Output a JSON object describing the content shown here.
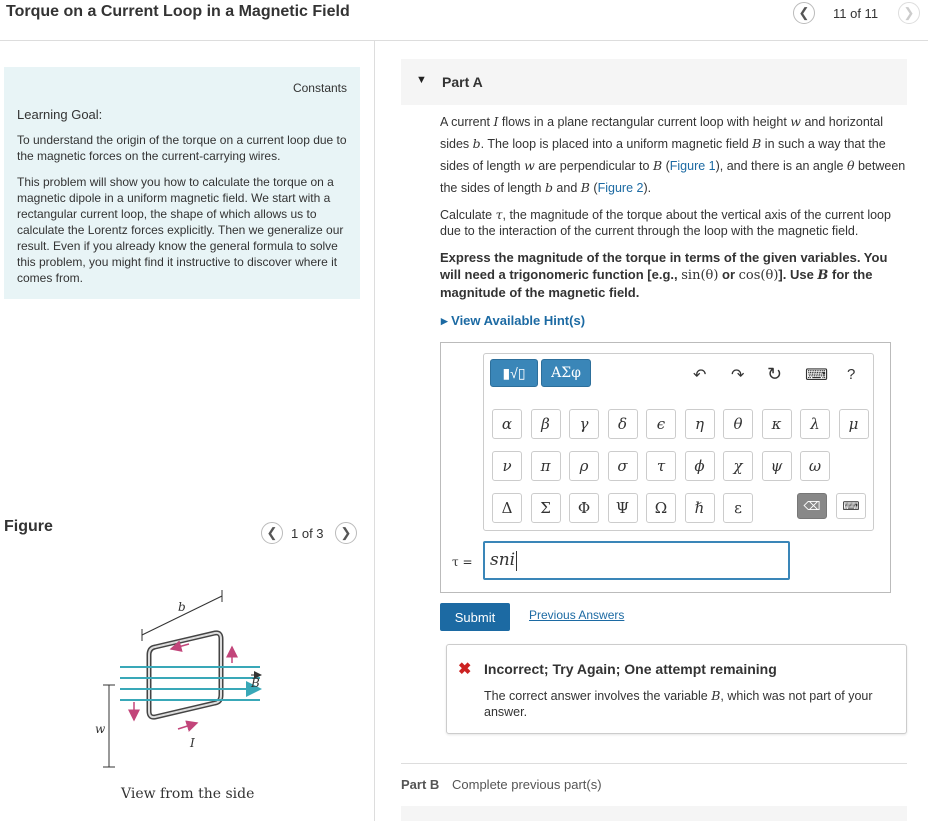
{
  "header": {
    "title": "Torque on a Current Loop in a Magnetic Field",
    "counter": "11 of 11"
  },
  "goal_panel": {
    "constants": "Constants",
    "heading": "Learning Goal:",
    "p1": "To understand the origin of the torque on a current loop due to the magnetic forces on the current-carrying wires.",
    "p2": "This problem will show you how to calculate the torque on a magnetic dipole in a uniform magnetic field. We start with a rectangular current loop, the shape of which allows us to calculate the Lorentz forces explicitly. Then we generalize our result. Even if you already know the general formula to solve this problem, you might find it instructive to discover where it comes from."
  },
  "figure": {
    "label": "Figure",
    "counter": "1 of 3",
    "caption": "View from the side",
    "labels": {
      "b": "b",
      "w": "w",
      "I": "I",
      "B": "B"
    }
  },
  "part_a": {
    "label": "Part A",
    "p1": {
      "a": "A current ",
      "I": "I",
      "b": " flows in a plane rectangular current loop with height ",
      "w": "w",
      "c": " and horizontal sides ",
      "bv": "b",
      "d": ". The loop is placed into a uniform magnetic field ",
      "B": "B",
      "e": " in such a way that the sides of length ",
      "w2": "w",
      "f": " are perpendicular to ",
      "B2": "B",
      "g": " (",
      "fig1": "Figure 1",
      "h": "), and there is an angle ",
      "theta": "θ",
      "i": " between the sides of length ",
      "b2": "b",
      "j": " and ",
      "B3": "B",
      "k": " (",
      "fig2": "Figure 2",
      "l": ")."
    },
    "p2": {
      "a": "Calculate ",
      "tau": "τ",
      "b": ", the magnitude of the torque about the vertical axis of the current loop due to the interaction of the current through the loop with the magnetic field."
    },
    "p3": {
      "a": "Express the magnitude of the torque in terms of the given variables. You will need a trigonomeric function [e.g., ",
      "sin": "sin(θ)",
      "b": " or ",
      "cos": "cos(θ)",
      "c": "]. Use ",
      "B": "B",
      "d": " for the magnitude of the magnetic field."
    },
    "hints": "▸ View Available Hint(s)"
  },
  "editor": {
    "template_btn": "▮√▯",
    "greek_btn": "ΑΣφ",
    "undo": "↶",
    "redo": "↷",
    "reset": "↻",
    "keyboard": "⌨",
    "help": "?",
    "row1": [
      "α",
      "β",
      "γ",
      "δ",
      "ϵ",
      "η",
      "θ",
      "κ",
      "λ",
      "μ"
    ],
    "row2": [
      "ν",
      "π",
      "ρ",
      "σ",
      "τ",
      "ϕ",
      "χ",
      "ψ",
      "ω"
    ],
    "row3": [
      "Δ",
      "Σ",
      "Φ",
      "Ψ",
      "Ω",
      "ℏ",
      "ε"
    ],
    "delete": "⌫",
    "answer_label": "τ =",
    "answer_value": "sni"
  },
  "actions": {
    "submit": "Submit",
    "previous": "Previous Answers"
  },
  "feedback": {
    "icon": "✖",
    "title": "Incorrect; Try Again; One attempt remaining",
    "text_a": "The correct answer involves the variable ",
    "text_var": "B",
    "text_b": ", which was not part of your answer."
  },
  "part_b": {
    "label": "Part B",
    "status": "Complete previous part(s)"
  },
  "colors": {
    "accent": "#1c6aa3",
    "panel": "#e8f4f6",
    "error": "#cc2222"
  }
}
